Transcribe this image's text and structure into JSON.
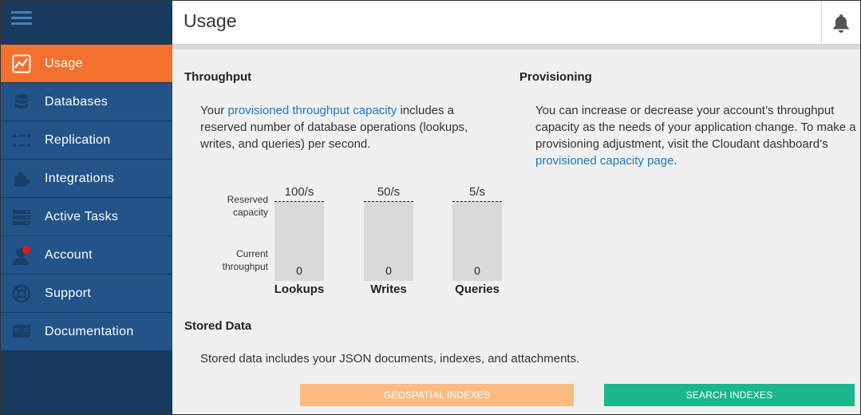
{
  "header": {
    "title": "Usage"
  },
  "sidebar": {
    "items": [
      {
        "label": "Usage",
        "icon": "usage-chart-icon",
        "active": true
      },
      {
        "label": "Databases",
        "icon": "database-icon",
        "active": false
      },
      {
        "label": "Replication",
        "icon": "replication-icon",
        "active": false
      },
      {
        "label": "Integrations",
        "icon": "puzzle-piece-icon",
        "active": false
      },
      {
        "label": "Active Tasks",
        "icon": "server-stack-icon",
        "active": false
      },
      {
        "label": "Account",
        "icon": "user-icon",
        "active": false
      },
      {
        "label": "Support",
        "icon": "life-ring-icon",
        "active": false
      },
      {
        "label": "Documentation",
        "icon": "book-icon",
        "active": false
      }
    ]
  },
  "throughput": {
    "heading": "Throughput",
    "text_before": "Your ",
    "link": "provisioned throughput capacity",
    "text_after": " includes a reserved number of database operations (lookups, writes, and queries) per second.",
    "reserved_label_1": "Reserved",
    "reserved_label_2": "capacity",
    "current_label_1": "Current",
    "current_label_2": "throughput",
    "columns": [
      {
        "label": "Lookups",
        "capacity": "100/s",
        "current": "0"
      },
      {
        "label": "Writes",
        "capacity": "50/s",
        "current": "0"
      },
      {
        "label": "Queries",
        "capacity": "5/s",
        "current": "0"
      }
    ]
  },
  "provisioning": {
    "heading": "Provisioning",
    "text_before": "You can increase or decrease your account’s throughput capacity as the needs of your application change. To make a provisioning adjustment, visit the Cloudant dashboard’s ",
    "link": "provisioned capacity page",
    "text_after": "."
  },
  "stored_data": {
    "heading": "Stored Data",
    "text": "Stored data includes your JSON documents, indexes, and attachments."
  },
  "buttons": {
    "geospatial": "GEOSPATIAL INDEXES",
    "search": "SEARCH INDEXES"
  },
  "colors": {
    "sidebar_bg": "#173a5e",
    "nav_item_bg": "#225489",
    "active_orange": "#f3702e",
    "link_blue": "#1b7ac0",
    "geo_button": "#fbbb82",
    "search_button": "#1bb58e",
    "account_badge": "#e8121b"
  }
}
